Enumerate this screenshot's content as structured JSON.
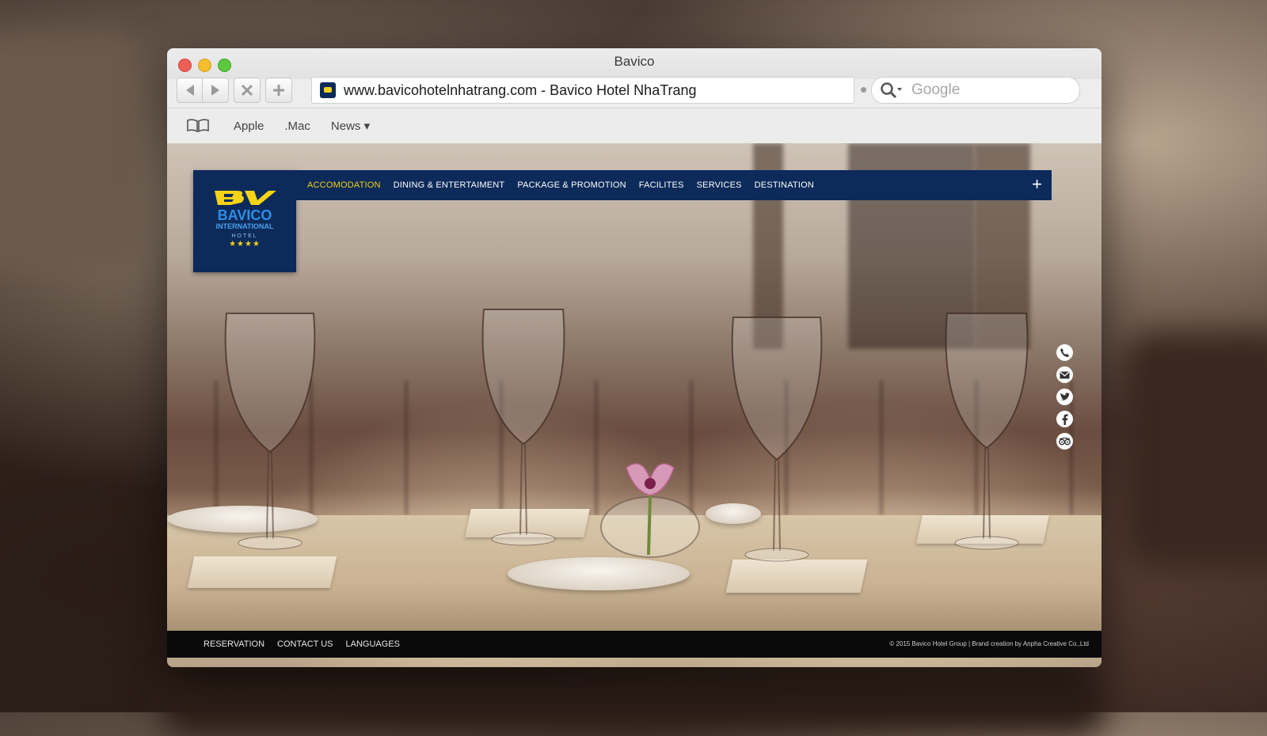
{
  "browser": {
    "window_title": "Bavico",
    "address": "www.bavicohotelnhatrang.com - Bavico Hotel NhaTrang",
    "search_placeholder": "Google",
    "nav_buttons": [
      "back-icon",
      "forward-icon",
      "close-icon",
      "plus-icon"
    ],
    "bookmarks": [
      {
        "label": "Apple"
      },
      {
        "label": ".Mac"
      },
      {
        "label": "News ▾"
      }
    ]
  },
  "site": {
    "logo": {
      "mark": "BV",
      "name": "BAVICO",
      "line1": "INTERNATIONAL",
      "line2": "HOTEL",
      "stars": "★★★★"
    },
    "nav": [
      {
        "label": "ACCOMODATION",
        "active": true
      },
      {
        "label": "DINING & ENTERTAIMENT",
        "active": false
      },
      {
        "label": "PACKAGE & PROMOTION",
        "active": false
      },
      {
        "label": "FACILITES",
        "active": false
      },
      {
        "label": "SERVICES",
        "active": false
      },
      {
        "label": "DESTINATION",
        "active": false
      }
    ],
    "nav_plus": "+",
    "social_icons": [
      "phone-icon",
      "email-icon",
      "twitter-icon",
      "facebook-icon",
      "tripadvisor-icon"
    ],
    "footer": {
      "links": [
        "RESERVATION",
        "CONTACT US",
        "LANGUAGES"
      ],
      "copyright": "© 2015 Bavico Hotel Group  |  Brand creation by Anpha Creative Co.,Ltd"
    }
  },
  "colors": {
    "brand_navy": "#0c2a5a",
    "brand_yellow": "#f5d316",
    "nav_active": "#f5d316",
    "footer_bg": "#0a0a0a"
  }
}
